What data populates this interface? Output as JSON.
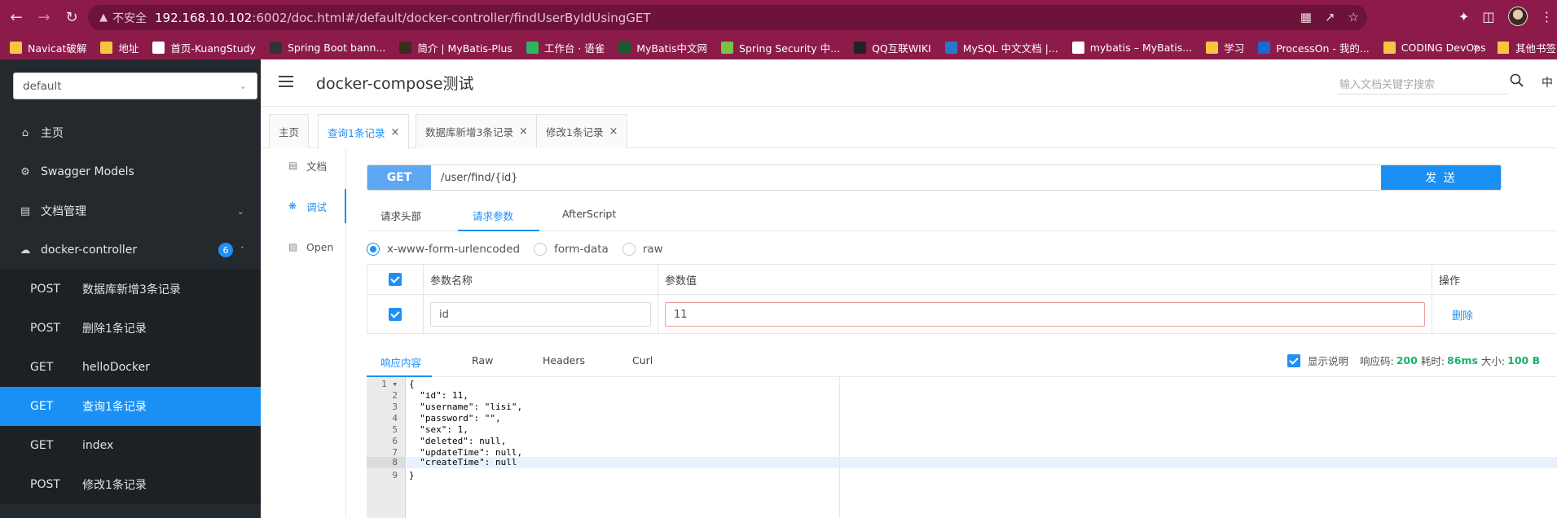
{
  "browser": {
    "insecure_label": "不安全",
    "url_host": "192.168.10.102",
    "url_path": ":6002/doc.html#/default/docker-controller/findUserByIdUsingGET",
    "bookmarks": [
      {
        "label": "Navicat破解",
        "color": "#f6c443"
      },
      {
        "label": "地址",
        "color": "#f6c443"
      },
      {
        "label": "首页-KuangStudy",
        "color": "#ffffff"
      },
      {
        "label": "Spring Boot bann...",
        "color": "#333333"
      },
      {
        "label": "简介 | MyBatis-Plus",
        "color": "#3d2b1f"
      },
      {
        "label": "工作台 · 语雀",
        "color": "#31b35e"
      },
      {
        "label": "MyBatis中文网",
        "color": "#1e5c2e"
      },
      {
        "label": "Spring Security 中...",
        "color": "#7cc142"
      },
      {
        "label": "QQ互联WIKI",
        "color": "#222222"
      },
      {
        "label": "MySQL 中文文档 |...",
        "color": "#2b78c8"
      },
      {
        "label": "mybatis – MyBatis...",
        "color": "#ffffff"
      },
      {
        "label": "学习",
        "color": "#f6c443"
      },
      {
        "label": "ProcessOn - 我的...",
        "color": "#1769d8"
      },
      {
        "label": "CODING DevOps",
        "color": "#f6c443"
      }
    ],
    "more": "»",
    "other_bookmarks": "其他书签"
  },
  "sidebar": {
    "group_select": "default",
    "items": [
      {
        "label": "主页",
        "icon": "home-icon"
      },
      {
        "label": "Swagger Models",
        "icon": "model-icon"
      },
      {
        "label": "文档管理",
        "icon": "doc-manage-icon"
      },
      {
        "label": "docker-controller",
        "icon": "cloud-icon",
        "badge": "6"
      }
    ],
    "endpoints": [
      {
        "method": "POST",
        "label": "数据库新增3条记录"
      },
      {
        "method": "POST",
        "label": "删除1条记录"
      },
      {
        "method": "GET",
        "label": "helloDocker"
      },
      {
        "method": "GET",
        "label": "查询1条记录"
      },
      {
        "method": "GET",
        "label": "index"
      },
      {
        "method": "POST",
        "label": "修改1条记录"
      }
    ]
  },
  "header": {
    "title": "docker-compose测试",
    "search_placeholder": "输入文档关键字搜索",
    "lang": "中"
  },
  "tabs": [
    {
      "label": "主页"
    },
    {
      "label": "查询1条记录"
    },
    {
      "label": "数据库新增3条记录"
    },
    {
      "label": "修改1条记录"
    }
  ],
  "side_menu": [
    {
      "label": "文档"
    },
    {
      "label": "调试"
    },
    {
      "label": "Open"
    }
  ],
  "request": {
    "method": "GET",
    "path": "/user/find/{id}",
    "send": "发 送"
  },
  "sub_tabs": [
    "请求头部",
    "请求参数",
    "AfterScript"
  ],
  "body_types": [
    "x-www-form-urlencoded",
    "form-data",
    "raw"
  ],
  "params": {
    "headers": {
      "name": "参数名称",
      "value": "参数值",
      "op": "操作"
    },
    "rows": [
      {
        "name": "id",
        "value": "11",
        "op": "删除"
      }
    ]
  },
  "response": {
    "tabs": [
      "响应内容",
      "Raw",
      "Headers",
      "Curl"
    ],
    "show_desc": "显示说明",
    "code_label": "响应码:",
    "code": "200",
    "time_label": "耗时:",
    "time": "86ms",
    "size_label": "大小:",
    "size": "100 B",
    "lines": [
      "{",
      "  \"id\": 11,",
      "  \"username\": \"lisi\",",
      "  \"password\": \"\",",
      "  \"sex\": 1,",
      "  \"deleted\": null,",
      "  \"updateTime\": null,",
      "  \"createTime\": null",
      "}"
    ]
  }
}
